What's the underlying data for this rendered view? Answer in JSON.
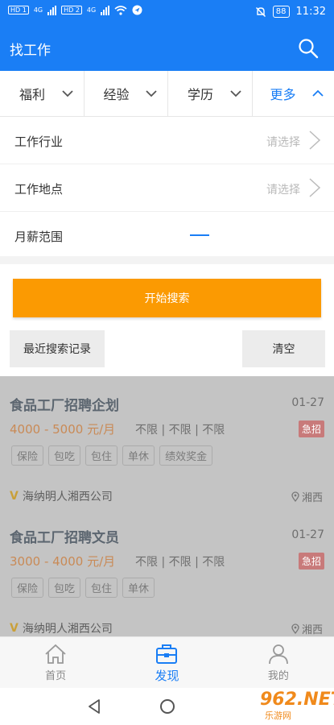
{
  "status_bar": {
    "hd1": "HD 1",
    "hd2": "HD 2",
    "net1": "4G",
    "net2": "4G",
    "battery": "88",
    "time": "11:32"
  },
  "header": {
    "title": "找工作",
    "icon": "search-icon"
  },
  "filters": [
    {
      "label": "福利"
    },
    {
      "label": "经验"
    },
    {
      "label": "学历"
    },
    {
      "label": "更多"
    }
  ],
  "form": {
    "industry_label": "工作行业",
    "industry_placeholder": "请选择",
    "location_label": "工作地点",
    "location_placeholder": "请选择",
    "salary_label": "月薪范围"
  },
  "actions": {
    "search_label": "开始搜索",
    "recent_label": "最近搜索记录",
    "clear_label": "清空"
  },
  "jobs": [
    {
      "title": "食品工厂招聘企划",
      "date": "01-27",
      "salary": "4000 - 5000 元/月",
      "requirements": "不限 | 不限 | 不限",
      "urgent": "急招",
      "tags": [
        "保险",
        "包吃",
        "包住",
        "单休",
        "绩效奖金"
      ],
      "company": "海纳明人湘西公司",
      "location": "湘西"
    },
    {
      "title": "食品工厂招聘文员",
      "date": "01-27",
      "salary": "3000 - 4000 元/月",
      "requirements": "不限 | 不限 | 不限",
      "urgent": "急招",
      "tags": [
        "保险",
        "包吃",
        "包住",
        "单休"
      ],
      "company": "海纳明人湘西公司",
      "location": "湘西"
    }
  ],
  "bottom_nav": [
    {
      "label": "首页",
      "icon": "home-icon"
    },
    {
      "label": "发现",
      "icon": "briefcase-icon"
    },
    {
      "label": "我的",
      "icon": "profile-icon"
    }
  ],
  "watermark": {
    "big": "962.NET",
    "small": "乐游网"
  },
  "colors": {
    "primary": "#1a7ef5",
    "search_button": "#fb9a02"
  }
}
